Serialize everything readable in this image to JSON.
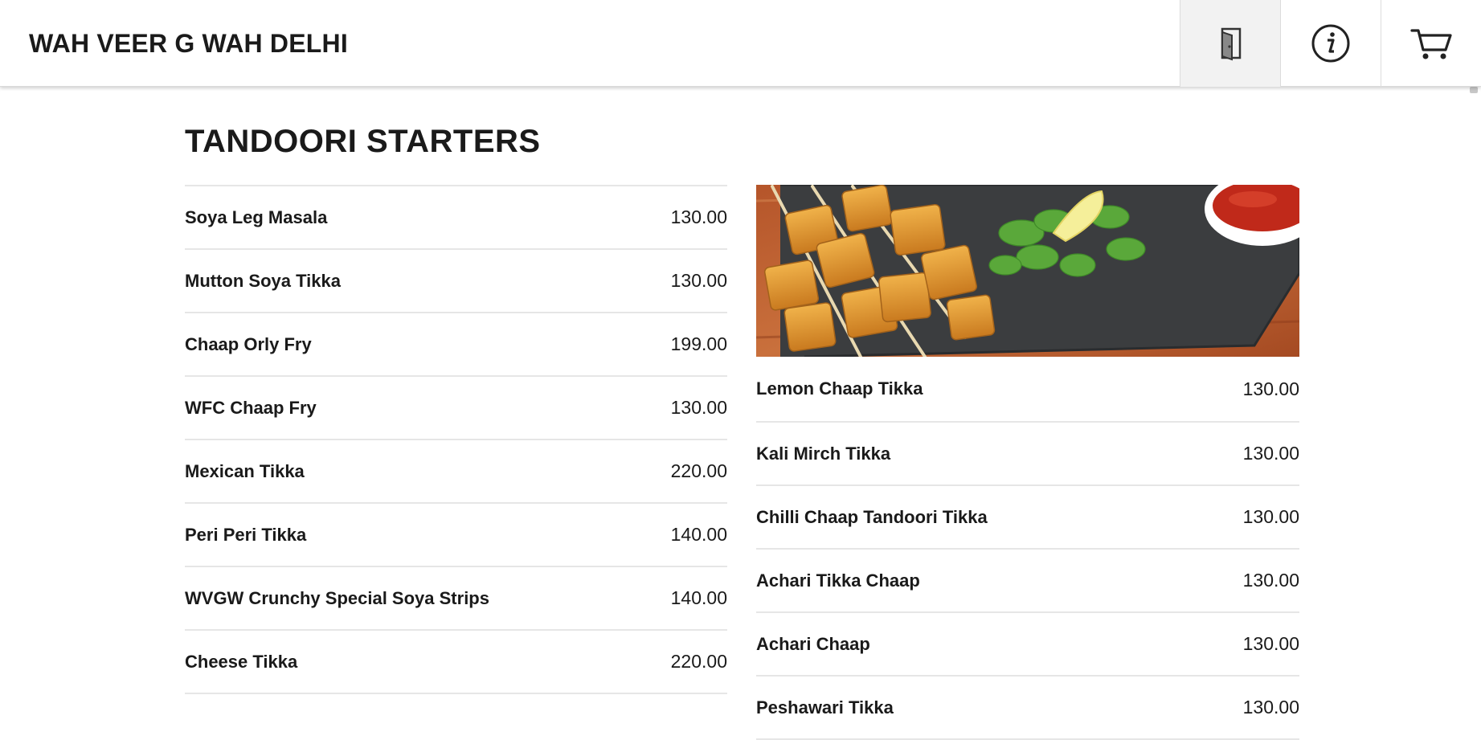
{
  "header": {
    "title": "WAH VEER G WAH DELHI",
    "icons": [
      "door-exit-icon",
      "info-icon",
      "cart-icon"
    ]
  },
  "section": {
    "title": "TANDOORI STARTERS"
  },
  "menu_left": [
    {
      "name": "Soya Leg Masala",
      "price": "130.00"
    },
    {
      "name": "Mutton Soya Tikka",
      "price": "130.00"
    },
    {
      "name": "Chaap Orly Fry",
      "price": "199.00"
    },
    {
      "name": "WFC Chaap Fry",
      "price": "130.00"
    },
    {
      "name": "Mexican Tikka",
      "price": "220.00"
    },
    {
      "name": "Peri Peri Tikka",
      "price": "140.00"
    },
    {
      "name": "WVGW Crunchy Special Soya Strips",
      "price": "140.00"
    },
    {
      "name": "Cheese Tikka",
      "price": "220.00"
    }
  ],
  "menu_right": [
    {
      "name": "Lemon Chaap Tikka",
      "price": "130.00"
    },
    {
      "name": "Kali Mirch Tikka",
      "price": "130.00"
    },
    {
      "name": "Chilli Chaap Tandoori Tikka",
      "price": "130.00"
    },
    {
      "name": "Achari Tikka Chaap",
      "price": "130.00"
    },
    {
      "name": "Achari Chaap",
      "price": "130.00"
    },
    {
      "name": "Peshawari Tikka",
      "price": "130.00"
    }
  ],
  "colors": {
    "text": "#1a1a1a",
    "divider": "#e6e6e6",
    "active_button_bg": "#f2f2f2"
  }
}
